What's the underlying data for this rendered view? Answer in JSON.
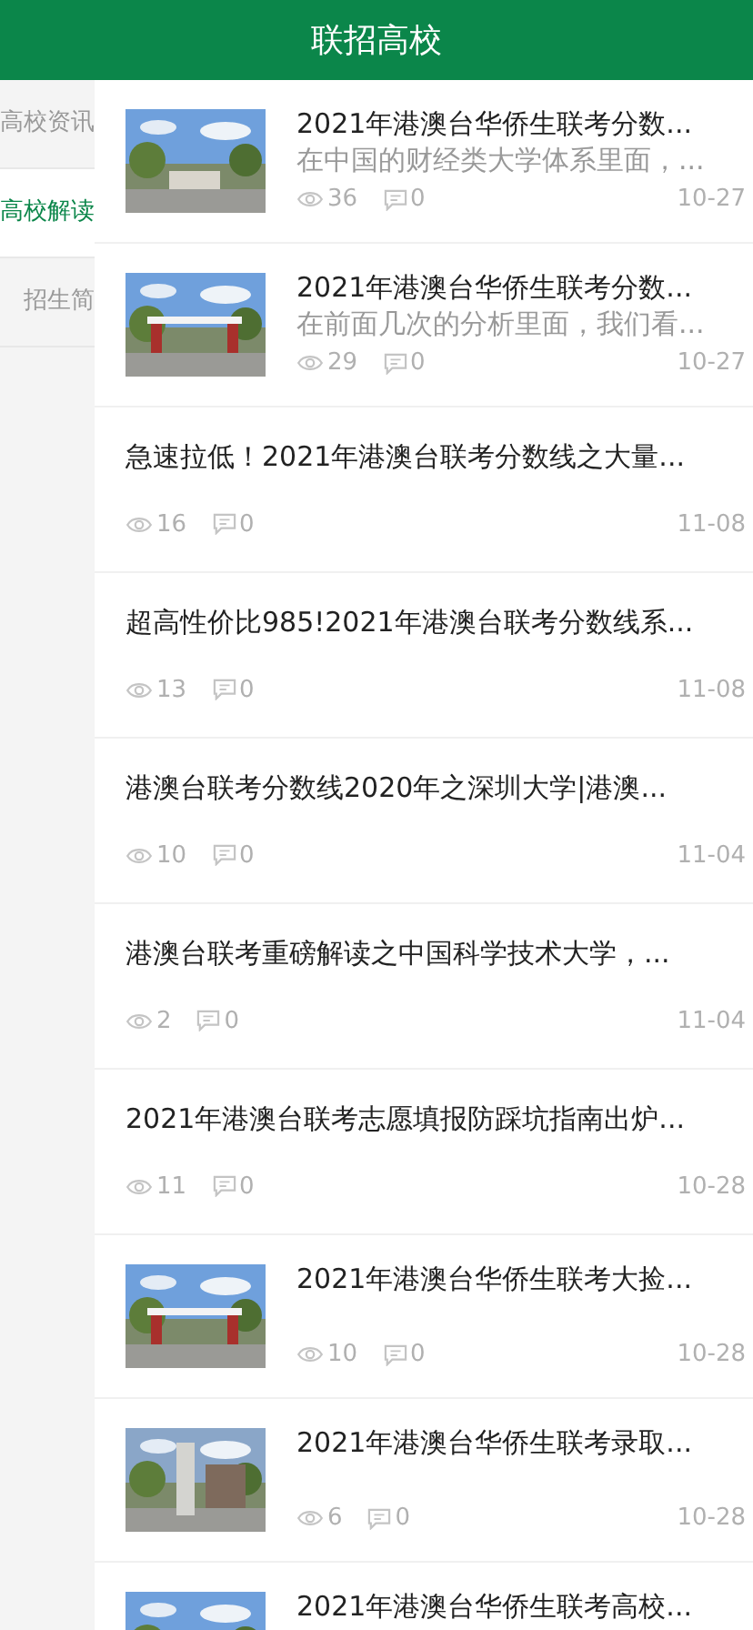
{
  "header": {
    "title": "联招高校"
  },
  "sidebar": {
    "items": [
      {
        "label": "高校资讯",
        "selected": false
      },
      {
        "label": "高校解读",
        "selected": true
      },
      {
        "label": "招生简",
        "selected": false
      }
    ]
  },
  "articles": [
    {
      "title": "2021年港澳台华侨生联考分数...",
      "summary": "在中国的财经类大学体系里面，...",
      "views": "36",
      "comments": "0",
      "date": "10-27"
    },
    {
      "title": "2021年港澳台华侨生联考分数...",
      "summary": "在前面几次的分析里面，我们看...",
      "views": "29",
      "comments": "0",
      "date": "10-27"
    },
    {
      "kind": "text",
      "title": "急速拉低！2021年港澳台联考分数线之大量...",
      "views": "16",
      "comments": "0",
      "date": "11-08"
    },
    {
      "kind": "text",
      "title": "超高性价比985!2021年港澳台联考分数线系...",
      "views": "13",
      "comments": "0",
      "date": "11-08"
    },
    {
      "kind": "text",
      "title": "港澳台联考分数线2020年之深圳大学|港澳...",
      "views": "10",
      "comments": "0",
      "date": "11-04"
    },
    {
      "kind": "text",
      "title": "港澳台联考重磅解读之中国科学技术大学，...",
      "views": "2",
      "comments": "0",
      "date": "11-04"
    },
    {
      "kind": "text",
      "title": "2021年港澳台联考志愿填报防踩坑指南出炉...",
      "views": "11",
      "comments": "0",
      "date": "10-28"
    },
    {
      "title": "2021年港澳台华侨生联考大捡...",
      "views": "10",
      "comments": "0",
      "date": "10-28"
    },
    {
      "title": "2021年港澳台华侨生联考录取...",
      "views": "6",
      "comments": "0",
      "date": "10-28"
    },
    {
      "title": "2021年港澳台华侨生联考高校..."
    }
  ]
}
